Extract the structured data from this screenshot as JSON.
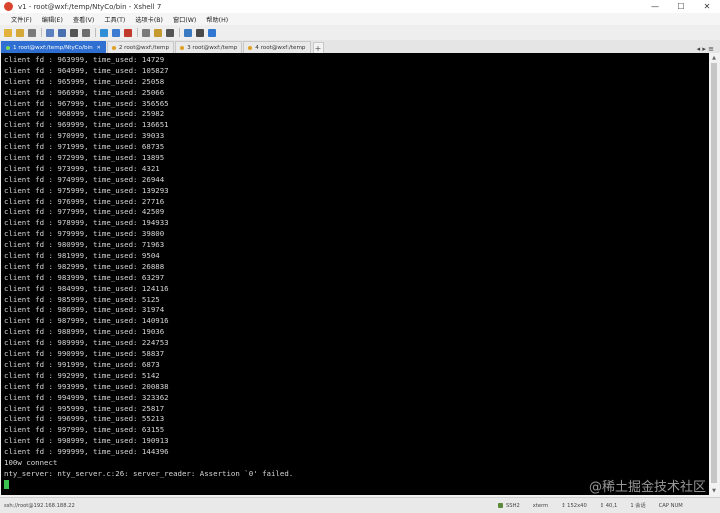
{
  "window": {
    "title": "v1 - root@wxf:/temp/NtyCo/bin - Xshell 7",
    "controls": {
      "minimize": "—",
      "maximize": "☐",
      "close": "✕"
    }
  },
  "menu": [
    "文件(F)",
    "编辑(E)",
    "查看(V)",
    "工具(T)",
    "选项卡(B)",
    "窗口(W)",
    "帮助(H)"
  ],
  "toolbar_icons": [
    {
      "name": "new-session-icon",
      "color": "#e3b23c"
    },
    {
      "name": "open-folder-icon",
      "color": "#d4a93a"
    },
    {
      "name": "disconnect-icon",
      "color": "#7a7a7a"
    },
    {
      "name": "copy-icon",
      "color": "#5b7fbf"
    },
    {
      "name": "paste-icon",
      "color": "#4a70b0"
    },
    {
      "name": "find-icon",
      "color": "#555555"
    },
    {
      "name": "print-icon",
      "color": "#6d6d6d"
    },
    {
      "name": "globe-icon",
      "color": "#2f8fd6"
    },
    {
      "name": "color-scheme-icon",
      "color": "#3d7bd2"
    },
    {
      "name": "font-icon",
      "color": "#c0392b"
    },
    {
      "name": "fullscreen-icon",
      "color": "#7b7b7b"
    },
    {
      "name": "lock-icon",
      "color": "#c59a2e"
    },
    {
      "name": "keyboard-icon",
      "color": "#555555"
    },
    {
      "name": "script-icon",
      "color": "#3a7ac2"
    },
    {
      "name": "layout-icon",
      "color": "#4a4a4a"
    },
    {
      "name": "help-icon",
      "color": "#2f77d0"
    }
  ],
  "tabs": [
    {
      "label": "1 root@wxf:/temp/NtyCo/bin",
      "active": true,
      "dot": "#7ed957"
    },
    {
      "label": "2 root@wxf:/temp",
      "active": false,
      "dot": "#e0a020"
    },
    {
      "label": "3 root@wxf:/temp",
      "active": false,
      "dot": "#e0a020"
    },
    {
      "label": "4 root@wxf:/temp",
      "active": false,
      "dot": "#e0a020"
    }
  ],
  "tab_add": "+",
  "tab_menu": "◂ ▸ ≡",
  "terminal": {
    "lines": [
      "client fd : 963999, time_used: 14729",
      "client fd : 964999, time_used: 105827",
      "client fd : 965999, time_used: 25058",
      "client fd : 966999, time_used: 25066",
      "client fd : 967999, time_used: 356565",
      "client fd : 968999, time_used: 25982",
      "client fd : 969999, time_used: 136651",
      "client fd : 970999, time_used: 39033",
      "client fd : 971999, time_used: 68735",
      "client fd : 972999, time_used: 13895",
      "client fd : 973999, time_used: 4321",
      "client fd : 974999, time_used: 26944",
      "client fd : 975999, time_used: 139293",
      "client fd : 976999, time_used: 27716",
      "client fd : 977999, time_used: 42509",
      "client fd : 978999, time_used: 194933",
      "client fd : 979999, time_used: 39800",
      "client fd : 980999, time_used: 71963",
      "client fd : 981999, time_used: 9504",
      "client fd : 982999, time_used: 26888",
      "client fd : 983999, time_used: 63297",
      "client fd : 984999, time_used: 124116",
      "client fd : 985999, time_used: 5125",
      "client fd : 986999, time_used: 31974",
      "client fd : 987999, time_used: 140916",
      "client fd : 988999, time_used: 19036",
      "client fd : 989999, time_used: 224753",
      "client fd : 990999, time_used: 58837",
      "client fd : 991999, time_used: 6873",
      "client fd : 992999, time_used: 5142",
      "client fd : 993999, time_used: 200838",
      "client fd : 994999, time_used: 323362",
      "client fd : 995999, time_used: 25817",
      "client fd : 996999, time_used: 55213",
      "client fd : 997999, time_used: 63155",
      "client fd : 998999, time_used: 190913",
      "client fd : 999999, time_used: 144396",
      "100w connect",
      "nty_server: nty_server.c:26: server_reader: Assertion `0' failed."
    ],
    "cursor_color": "#39c24d",
    "text_color": "#d6d6d6",
    "background": "#000000"
  },
  "watermark": "@稀土掘金技术社区",
  "statusbar": {
    "connection": "ssh://root@192.168.188.22",
    "ssh": "SSH2",
    "term": "xterm",
    "size": "↕ 152x40",
    "cursor": "↕ 40,1",
    "sessions": "1 会话",
    "caps": "CAP NUM"
  }
}
